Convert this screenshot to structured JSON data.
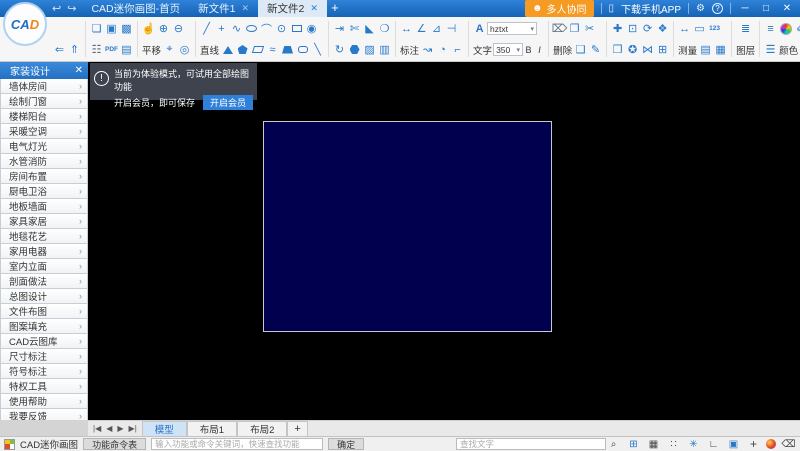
{
  "titlebar": {
    "tabs": [
      {
        "label": "CAD迷你画图-首页"
      },
      {
        "label": "新文件1"
      },
      {
        "label": "新文件2"
      }
    ],
    "collab": "多人协同",
    "download_app": "下载手机APP"
  },
  "toolbar": {
    "pan_label": "平移",
    "line_label": "直线",
    "dim_label": "标注",
    "text_label": "文字",
    "delete_label": "删除",
    "measure_label": "测量",
    "layer_label": "图层",
    "color_label": "颜色",
    "font_name": "hztxt",
    "font_size": "350",
    "bold": "B",
    "italic": "I",
    "pdf": "PDF",
    "m123": "123",
    "palette_row1": [
      "#ffffff",
      "#e8431f",
      "#f3eb33",
      "#8dc63f"
    ],
    "palette_row2": [
      "#000000",
      "#2aa6d8",
      "#2fa952",
      "#7d3fc0"
    ]
  },
  "sidebar": {
    "title": "家装设计",
    "items": [
      "墙体房间",
      "绘制门窗",
      "楼梯阳台",
      "采暖空调",
      "电气灯光",
      "水管消防",
      "房间布置",
      "厨电卫浴",
      "地板墙面",
      "家具家居",
      "地毯花艺",
      "家用电器",
      "室内立面",
      "剖面做法",
      "总图设计",
      "文件布图",
      "图案填充",
      "CAD云图库",
      "尺寸标注",
      "符号标注",
      "特权工具",
      "使用帮助",
      "我要反馈"
    ]
  },
  "banner": {
    "line1": "当前为体验模式，可试用全部绘图功能",
    "line2": "开启会员，即可保存",
    "button": "开启会员",
    "warn": "!"
  },
  "layout": {
    "tabs": [
      "模型",
      "布局1",
      "布局2"
    ],
    "add": "+"
  },
  "statusbar": {
    "app_name": "CAD迷你画图",
    "commands_button": "功能命令表",
    "search_placeholder": "输入功能或命令关键词，快速查找功能",
    "confirm": "确定",
    "find_placeholder": "查找文字"
  },
  "canvas": {
    "rect_color": "#00004f",
    "rect_border": "#c9c9c9",
    "background": "#000000"
  },
  "icons": {
    "back": "↩",
    "forward": "↪",
    "person": "☻",
    "phone": "▯",
    "gear": "⚙",
    "help": "?",
    "minimize": "─",
    "maximize": "□",
    "close": "✕",
    "tab_close": "✕",
    "new_tab": "+",
    "page_back": "⇐",
    "page_up": "⇑",
    "open": "❏",
    "save": "▣",
    "save_as": "▩",
    "print": "☷",
    "image": "▤",
    "hand": "☝",
    "zoom_in": "⊕",
    "zoom_out": "⊖",
    "zoom_win": "⌖",
    "zoom_ext": "◎",
    "line": "╱",
    "point": "+",
    "polyline": "∿",
    "arc": "⌒",
    "circle": "⊙",
    "revcloud": "◉",
    "spline": "≈",
    "ray": "╲",
    "ellipse": "css-ellipse",
    "rect": "css-rect",
    "roundrect": "css-roundrect",
    "triangle": "css-triangle",
    "pentagon": "css-pentagon",
    "parallelogram": "css-parallelogram",
    "trapezoid": "css-trapezoid",
    "polygon": "css-hexagon",
    "offset": "⇥",
    "trim": "✄",
    "chamfer": "◣",
    "lasso": "❍",
    "rot_array": "↻",
    "hatch": "▨",
    "block": "▥",
    "dim_linear": "↔",
    "dim_angle": "∠",
    "dim_tri": "⊿",
    "dim_h": "⊣",
    "dim_leader": "↝",
    "dim_arc": "◔",
    "dim_fillet": "⌐",
    "text_a": "A",
    "trash": "⌦",
    "copy": "❐",
    "cut": "✂",
    "paste": "❑",
    "brush": "✎",
    "move": "✚",
    "scale": "⊡",
    "rotate": "⟳",
    "explode": "❖",
    "clip": "❒",
    "stamp": "✪",
    "mirror": "⋈",
    "array": "⊞",
    "m_dim": "↔",
    "m_screen": "▭",
    "m_img": "▤",
    "m_table": "▦",
    "layers": "≣",
    "lines": "≡",
    "linestyle": "☰",
    "matchprop": "✐",
    "matchprop2": "✑",
    "chevron": "›",
    "nav_first": "|◀",
    "nav_prev": "◀",
    "nav_next": "▶",
    "nav_last": "▶|",
    "find": "⌕",
    "snap": "⊞",
    "grid": "▦",
    "dotgrid": "∷",
    "polar": "✳",
    "ortho": "∟",
    "display": "▣",
    "crosshair": "+",
    "eraser": "⌫"
  }
}
